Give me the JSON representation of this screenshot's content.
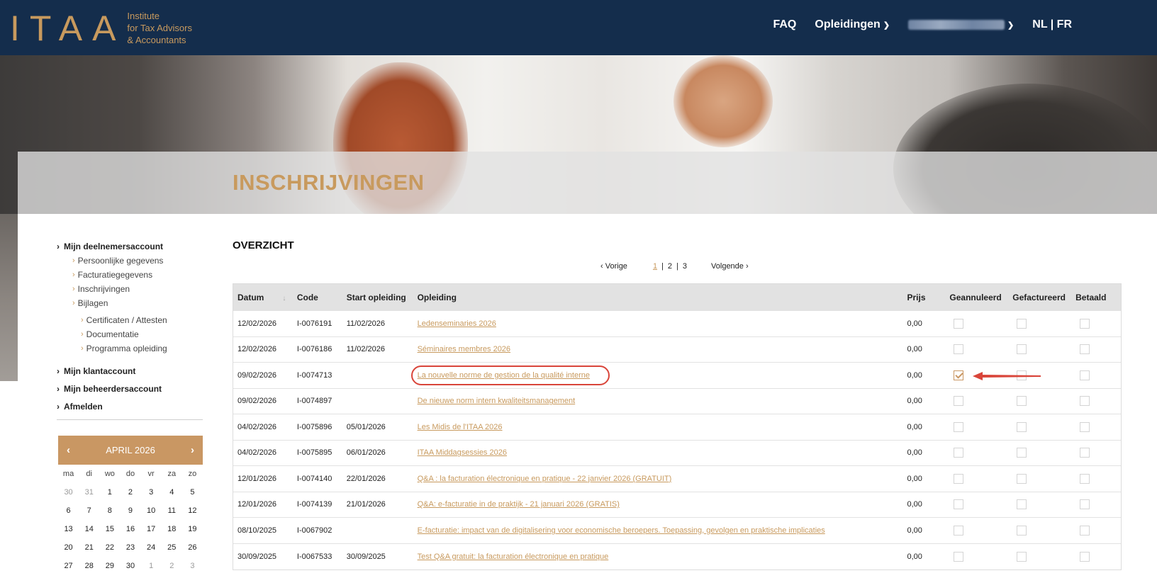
{
  "header": {
    "logo_mark": "ITAA",
    "logo_text": [
      "Institute",
      "for Tax Advisors",
      "& Accountants"
    ],
    "nav": {
      "faq": "FAQ",
      "opleidingen": "Opleidingen",
      "languages": "NL | FR"
    }
  },
  "hero": {
    "title": "INSCHRIJVINGEN"
  },
  "sidebar": {
    "account": "Mijn deelnemersaccount",
    "sub_items": [
      "Persoonlijke gegevens",
      "Facturatiegegevens",
      "Inschrijvingen",
      "Bijlagen"
    ],
    "bijlagen_items": [
      "Certificaten / Attesten",
      "Documentatie",
      "Programma opleiding"
    ],
    "klant": "Mijn klantaccount",
    "beheerder": "Mijn beheerdersaccount",
    "afmelden": "Afmelden"
  },
  "calendar": {
    "month_label": "APRIL 2026",
    "weekdays": [
      "ma",
      "di",
      "wo",
      "do",
      "vr",
      "za",
      "zo"
    ],
    "weeks": [
      [
        "30",
        "31",
        "1",
        "2",
        "3",
        "4",
        "5"
      ],
      [
        "6",
        "7",
        "8",
        "9",
        "10",
        "11",
        "12"
      ],
      [
        "13",
        "14",
        "15",
        "16",
        "17",
        "18",
        "19"
      ],
      [
        "20",
        "21",
        "22",
        "23",
        "24",
        "25",
        "26"
      ],
      [
        "27",
        "28",
        "29",
        "30",
        "1",
        "2",
        "3"
      ]
    ]
  },
  "overview": {
    "title": "OVERZICHT",
    "pagination": {
      "prev": "Vorige",
      "pages": [
        "1",
        "2",
        "3"
      ],
      "current_page": "1",
      "next": "Volgende"
    },
    "columns": {
      "datum": "Datum",
      "code": "Code",
      "start": "Start opleiding",
      "opleiding": "Opleiding",
      "prijs": "Prijs",
      "geannuleerd": "Geannuleerd",
      "gefactureerd": "Gefactureerd",
      "betaald": "Betaald"
    },
    "rows": [
      {
        "datum": "12/02/2026",
        "code": "I-0076191",
        "start": "11/02/2026",
        "opleiding": "Ledenseminaries 2026",
        "prijs": "0,00",
        "geannuleerd": false,
        "gefactureerd": false,
        "betaald": false
      },
      {
        "datum": "12/02/2026",
        "code": "I-0076186",
        "start": "11/02/2026",
        "opleiding": "Séminaires membres 2026",
        "prijs": "0,00",
        "geannuleerd": false,
        "gefactureerd": false,
        "betaald": false
      },
      {
        "datum": "09/02/2026",
        "code": "I-0074713",
        "start": "",
        "opleiding": "La nouvelle norme de gestion de la qualité interne",
        "prijs": "0,00",
        "geannuleerd": true,
        "gefactureerd": false,
        "betaald": false
      },
      {
        "datum": "09/02/2026",
        "code": "I-0074897",
        "start": "",
        "opleiding": "De nieuwe norm intern kwaliteitsmanagement",
        "prijs": "0,00",
        "geannuleerd": false,
        "gefactureerd": false,
        "betaald": false
      },
      {
        "datum": "04/02/2026",
        "code": "I-0075896",
        "start": "05/01/2026",
        "opleiding": "Les Midis de l'ITAA 2026",
        "prijs": "0,00",
        "geannuleerd": false,
        "gefactureerd": false,
        "betaald": false
      },
      {
        "datum": "04/02/2026",
        "code": "I-0075895",
        "start": "06/01/2026",
        "opleiding": "ITAA Middagsessies 2026",
        "prijs": "0,00",
        "geannuleerd": false,
        "gefactureerd": false,
        "betaald": false
      },
      {
        "datum": "12/01/2026",
        "code": "I-0074140",
        "start": "22/01/2026",
        "opleiding": "Q&A : la facturation électronique en pratique - 22 janvier 2026 (GRATUIT)",
        "prijs": "0,00",
        "geannuleerd": false,
        "gefactureerd": false,
        "betaald": false
      },
      {
        "datum": "12/01/2026",
        "code": "I-0074139",
        "start": "21/01/2026",
        "opleiding": "Q&A: e-facturatie in de praktijk - 21 januari 2026 (GRATIS)",
        "prijs": "0,00",
        "geannuleerd": false,
        "gefactureerd": false,
        "betaald": false
      },
      {
        "datum": "08/10/2025",
        "code": "I-0067902",
        "start": "",
        "opleiding": "E-facturatie: impact van de digitalisering voor economische beroepers. Toepassing, gevolgen en praktische implicaties",
        "prijs": "0,00",
        "geannuleerd": false,
        "gefactureerd": false,
        "betaald": false
      },
      {
        "datum": "30/09/2025",
        "code": "I-0067533",
        "start": "30/09/2025",
        "opleiding": "Test Q&A gratuit: la facturation électronique en pratique",
        "prijs": "0,00",
        "geannuleerd": false,
        "gefactureerd": false,
        "betaald": false
      }
    ]
  },
  "colors": {
    "navy": "#142d4c",
    "gold": "#c89a5e",
    "annotation_red": "#d9453a"
  }
}
